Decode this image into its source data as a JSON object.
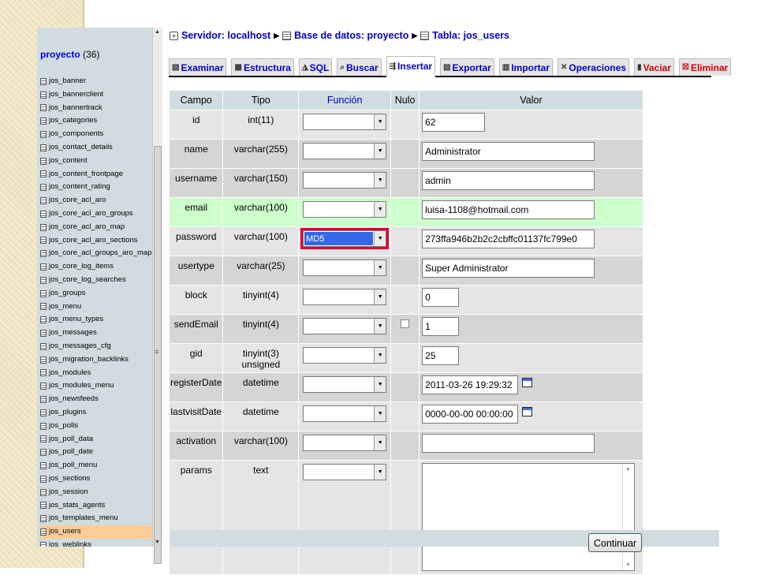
{
  "nav": {
    "db_name": "proyecto",
    "db_count": "(36)",
    "tables": [
      "jos_banner",
      "jos_bannerclient",
      "jos_bannertrack",
      "jos_categories",
      "jos_components",
      "jos_contact_details",
      "jos_content",
      "jos_content_frontpage",
      "jos_content_rating",
      "jos_core_acl_aro",
      "jos_core_acl_aro_groups",
      "jos_core_acl_aro_map",
      "jos_core_acl_aro_sections",
      "jos_core_acl_groups_aro_map",
      "jos_core_log_items",
      "jos_core_log_searches",
      "jos_groups",
      "jos_menu",
      "jos_menu_types",
      "jos_messages",
      "jos_messages_cfg",
      "jos_migration_backlinks",
      "jos_modules",
      "jos_modules_menu",
      "jos_newsfeeds",
      "jos_plugins",
      "jos_polls",
      "jos_poll_data",
      "jos_poll_date",
      "jos_poll_menu",
      "jos_sections",
      "jos_session",
      "jos_stats_agents",
      "jos_templates_menu",
      "jos_users",
      "jos_weblinks"
    ],
    "active_table": "jos_users"
  },
  "breadcrumb": {
    "server": "Servidor: localhost",
    "database": "Base de datos: proyecto",
    "table": "Tabla: jos_users"
  },
  "tabs": {
    "examinar": "Examinar",
    "estructura": "Estructura",
    "sql": "SQL",
    "buscar": "Buscar",
    "insertar": "Insertar",
    "exportar": "Exportar",
    "importar": "Importar",
    "operaciones": "Operaciones",
    "vaciar": "Vaciar",
    "eliminar": "Eliminar"
  },
  "table_headers": {
    "campo": "Campo",
    "tipo": "Tipo",
    "funcion": "Función",
    "nulo": "Nulo",
    "valor": "Valor"
  },
  "rows": [
    {
      "campo": "id",
      "tipo": "int(11)",
      "funcion": "",
      "valor": "62"
    },
    {
      "campo": "name",
      "tipo": "varchar(255)",
      "funcion": "",
      "valor": "Administrator"
    },
    {
      "campo": "username",
      "tipo": "varchar(150)",
      "funcion": "",
      "valor": "admin"
    },
    {
      "campo": "email",
      "tipo": "varchar(100)",
      "funcion": "",
      "valor": "luisa-1108@hotmail.com"
    },
    {
      "campo": "password",
      "tipo": "varchar(100)",
      "funcion": "MD5",
      "valor": "273ffa946b2b2c2cbffc01137fc799e0"
    },
    {
      "campo": "usertype",
      "tipo": "varchar(25)",
      "funcion": "",
      "valor": "Super Administrator"
    },
    {
      "campo": "block",
      "tipo": "tinyint(4)",
      "funcion": "",
      "valor": "0"
    },
    {
      "campo": "sendEmail",
      "tipo": "tinyint(4)",
      "funcion": "",
      "valor": "1"
    },
    {
      "campo": "gid",
      "tipo": "tinyint(3) unsigned",
      "funcion": "",
      "valor": "25"
    },
    {
      "campo": "registerDate",
      "tipo": "datetime",
      "funcion": "",
      "valor": "2011-03-26 19:29:32"
    },
    {
      "campo": "lastvisitDate",
      "tipo": "datetime",
      "funcion": "",
      "valor": "0000-00-00 00:00:00"
    },
    {
      "campo": "activation",
      "tipo": "varchar(100)",
      "funcion": "",
      "valor": ""
    },
    {
      "campo": "params",
      "tipo": "text",
      "funcion": "",
      "valor": ""
    }
  ],
  "footer": {
    "continue_label": "Continuar"
  },
  "colors": {
    "highlight_outline": "#e0002a",
    "selected_option": "#3369e8",
    "header_bg": "#d0dce0",
    "hover_row": "#ccffcc"
  }
}
